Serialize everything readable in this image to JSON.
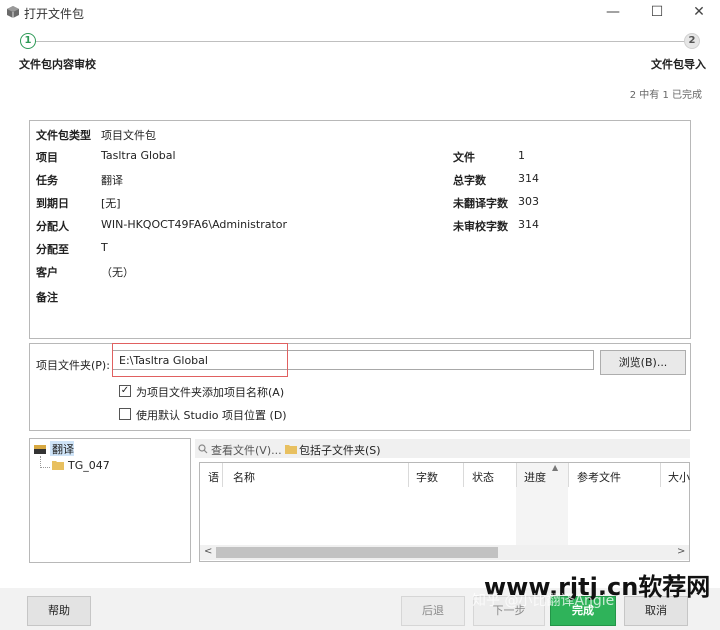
{
  "window": {
    "title": "打开文件包",
    "controls": [
      "—",
      "☐",
      "✕"
    ]
  },
  "steps": [
    {
      "number": "1",
      "label": "文件包内容审校"
    },
    {
      "number": "2",
      "label": "文件包导入"
    }
  ],
  "progress_text": "2 中有 1 已完成",
  "info": {
    "package_type_label": "文件包类型",
    "package_type_value": "项目文件包",
    "project_label": "项目",
    "project_value": "Tasltra Global",
    "task_label": "任务",
    "task_value": "翻译",
    "due_label": "到期日",
    "due_value": "[无]",
    "assigner_label": "分配人",
    "assigner_value": "WIN-HKQOCT49FA6\\Administrator",
    "assignee_label": "分配至",
    "assignee_value": "T",
    "customer_label": "客户",
    "customer_value": "（无）",
    "notes_label": "备注",
    "files_label": "文件",
    "files_value": "1",
    "total_words_label": "总字数",
    "total_words_value": "314",
    "untranslated_label": "未翻译字数",
    "untranslated_value": "303",
    "unreviewed_label": "未审校字数",
    "unreviewed_value": "314"
  },
  "folder": {
    "label": "项目文件夹(P):",
    "value": "E:\\Tasltra Global",
    "browse_label": "浏览(B)...",
    "checkbox1_label": "为项目文件夹添加项目名称(A)",
    "checkbox1_checked": true,
    "checkbox2_label": "使用默认 Studio 项目位置 (D)",
    "checkbox2_checked": false
  },
  "tree": {
    "root_label": "翻译",
    "child_label": "TG_047"
  },
  "files_toolbar": {
    "view_files_label": "查看文件(V)...",
    "include_subfolders_label": "包括子文件夹(S)"
  },
  "files_table": {
    "columns": [
      "语",
      "名称",
      "字数",
      "状态",
      "进度",
      "参考文件",
      "大小"
    ]
  },
  "buttons": {
    "help": "帮助",
    "back": "后退",
    "next": "下一步",
    "finish": "完成",
    "cancel": "取消"
  },
  "watermark": {
    "site": "www.rjtj.cn软荐网",
    "overlay": "知乎 @小比翻译Angie"
  },
  "colors": {
    "accent_green": "#2fb35a",
    "highlight_red": "#e06060",
    "tree_selection": "#cfe4f8"
  }
}
